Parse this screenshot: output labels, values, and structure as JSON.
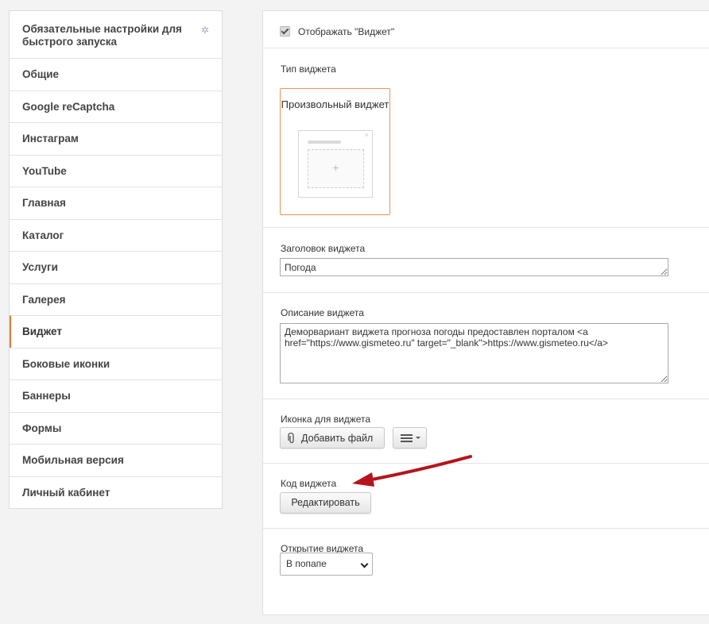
{
  "sidebar": {
    "items": [
      {
        "label": "Обязательные настройки для быстрого запуска",
        "icon": "asterisk-icon"
      },
      {
        "label": "Общие"
      },
      {
        "label": "Google reCaptcha"
      },
      {
        "label": "Инстаграм"
      },
      {
        "label": "YouTube"
      },
      {
        "label": "Главная"
      },
      {
        "label": "Каталог"
      },
      {
        "label": "Услуги"
      },
      {
        "label": "Галерея"
      },
      {
        "label": "Виджет",
        "active": true
      },
      {
        "label": "Боковые иконки"
      },
      {
        "label": "Баннеры"
      },
      {
        "label": "Формы"
      },
      {
        "label": "Мобильная версия"
      },
      {
        "label": "Личный кабинет"
      }
    ]
  },
  "main": {
    "show_widget": {
      "label": "Отображать \"Виджет\"",
      "checked": true
    },
    "widget_type": {
      "label": "Тип виджета",
      "card_title": "Произвольный виджет"
    },
    "widget_title": {
      "label": "Заголовок виджета",
      "value": "Погода"
    },
    "widget_description": {
      "label": "Описание виджета",
      "value": "Деморвариант виджета прогноза погоды предоставлен порталом <a href=\"https://www.gismeteo.ru\" target=\"_blank\">https://www.gismeteo.ru</a>"
    },
    "widget_icon": {
      "label": "Иконка для виджета",
      "add_file_label": "Добавить файл",
      "menu_icon": "hamburger-menu-icon"
    },
    "widget_code": {
      "label": "Код виджета",
      "edit_label": "Редактировать"
    },
    "widget_open": {
      "label": "Открытие виджета",
      "selected": "В попапе"
    }
  },
  "colors": {
    "accent": "#e07b39",
    "annotation_arrow": "#b5141a"
  }
}
